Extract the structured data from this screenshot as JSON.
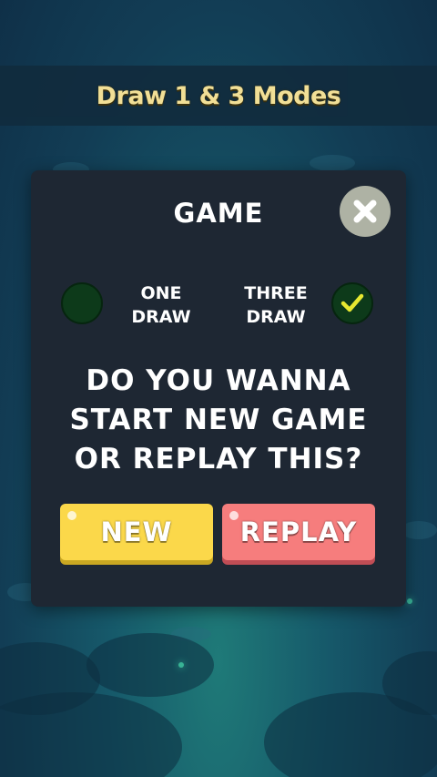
{
  "banner": {
    "title": "Draw 1 & 3 Modes"
  },
  "dialog": {
    "title": "GAME",
    "close_icon": "close-x-icon",
    "options": [
      {
        "label_line1": "ONE",
        "label_line2": "DRAW",
        "selected": false
      },
      {
        "label_line1": "THREE",
        "label_line2": "DRAW",
        "selected": true
      }
    ],
    "question": "DO YOU WANNA\nSTART NEW GAME\nOR REPLAY THIS?",
    "new_label": "NEW",
    "replay_label": "REPLAY"
  },
  "colors": {
    "banner_text": "#fde89a",
    "dialog_bg": "#1e2733",
    "check": "#e7e830",
    "new_button": "#fbd84a",
    "replay_button": "#f67d7d",
    "close_button": "#aeb2a4"
  }
}
